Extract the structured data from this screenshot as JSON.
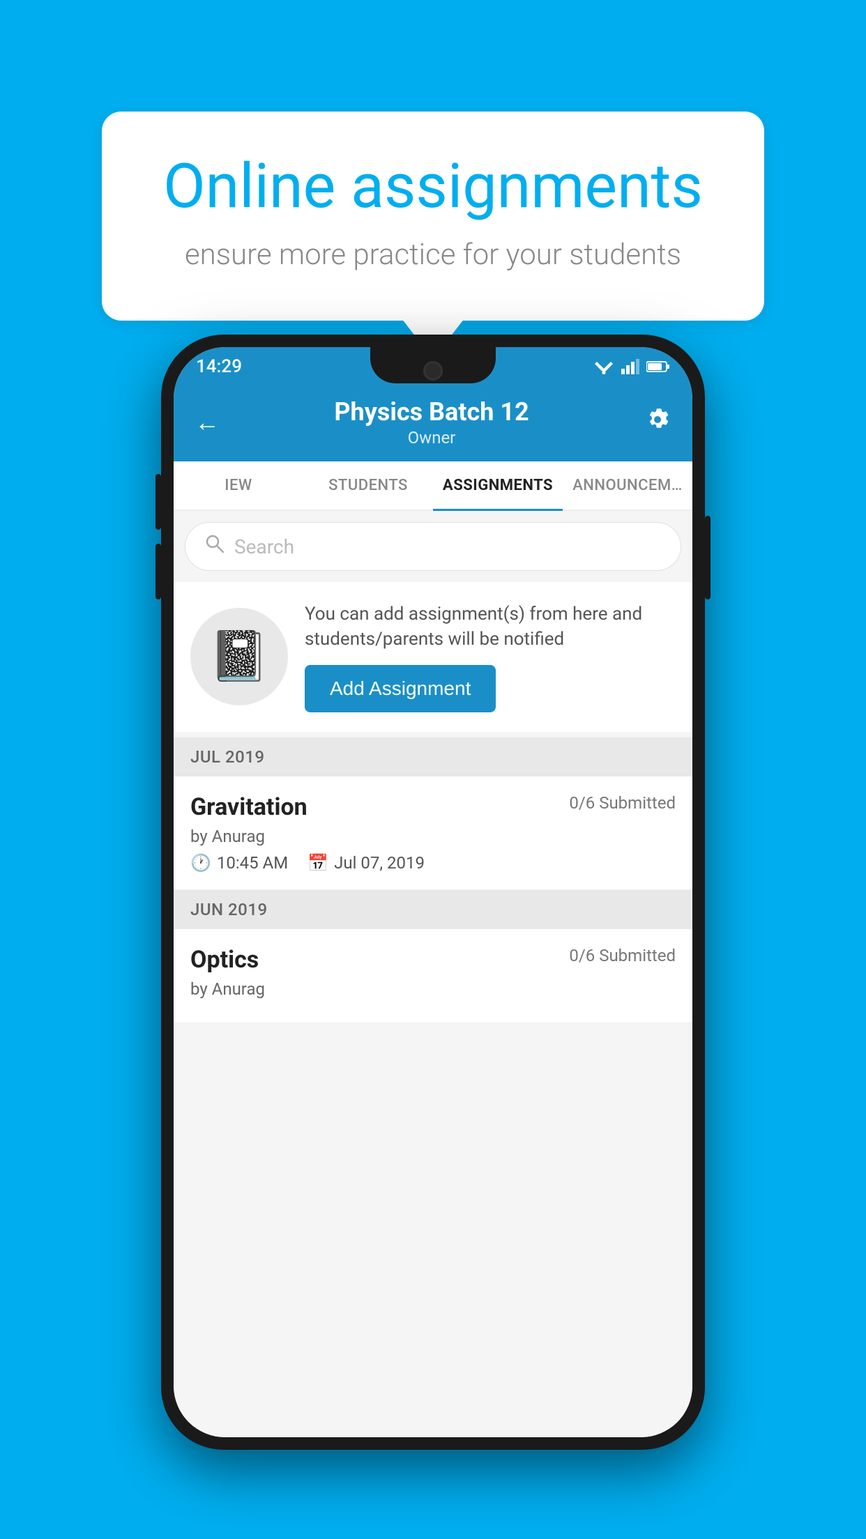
{
  "background_color": "#00AEEF",
  "speech_bubble": {
    "title": "Online assignments",
    "subtitle": "ensure more practice for your students"
  },
  "phone": {
    "status_bar": {
      "time": "14:29"
    },
    "header": {
      "title": "Physics Batch 12",
      "subtitle": "Owner",
      "back_label": "←",
      "gear_label": "⚙"
    },
    "tabs": [
      {
        "label": "IEW",
        "active": false
      },
      {
        "label": "STUDENTS",
        "active": false
      },
      {
        "label": "ASSIGNMENTS",
        "active": true
      },
      {
        "label": "ANNOUNCEM…",
        "active": false
      }
    ],
    "search": {
      "placeholder": "Search"
    },
    "info_card": {
      "description": "You can add assignment(s) from here and students/parents will be notified",
      "button_label": "Add Assignment"
    },
    "assignment_sections": [
      {
        "month": "JUL 2019",
        "assignments": [
          {
            "title": "Gravitation",
            "status": "0/6 Submitted",
            "by": "by Anurag",
            "time": "10:45 AM",
            "date": "Jul 07, 2019"
          }
        ]
      },
      {
        "month": "JUN 2019",
        "assignments": [
          {
            "title": "Optics",
            "status": "0/6 Submitted",
            "by": "by Anurag",
            "time": "",
            "date": ""
          }
        ]
      }
    ]
  }
}
